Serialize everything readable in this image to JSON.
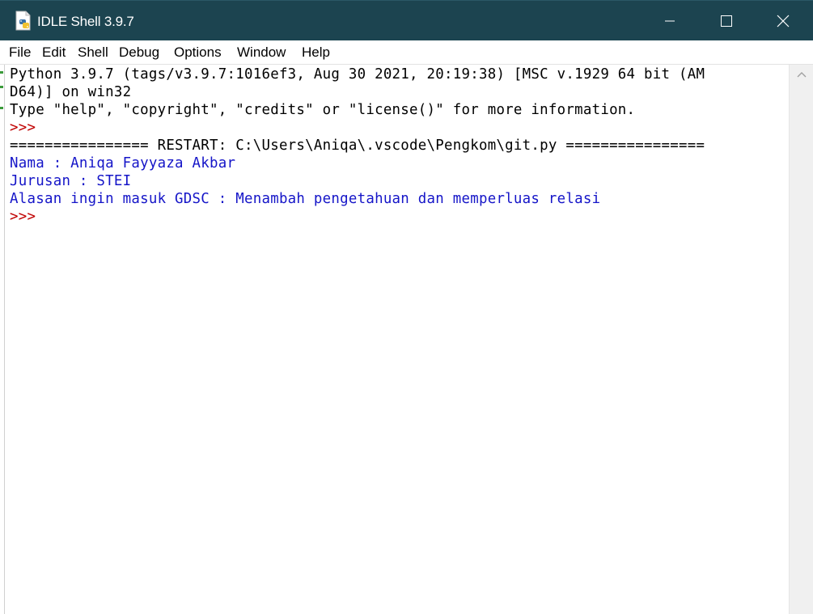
{
  "window": {
    "title": "IDLE Shell 3.9.7"
  },
  "menubar": {
    "items": [
      "File",
      "Edit",
      "Shell",
      "Debug",
      "Options",
      "Window",
      "Help"
    ]
  },
  "shell": {
    "lines": [
      {
        "text": "Python 3.9.7 (tags/v3.9.7:1016ef3, Aug 30 2021, 20:19:38) [MSC v.1929 64 bit (AM",
        "kind": "stdout-banner"
      },
      {
        "text": "D64)] on win32",
        "kind": "stdout-banner"
      },
      {
        "text": "Type \"help\", \"copyright\", \"credits\" or \"license()\" for more information.",
        "kind": "stdout-banner"
      },
      {
        "text": ">>> ",
        "kind": "prompt"
      },
      {
        "text": "================ RESTART: C:\\Users\\Aniqa\\.vscode\\Pengkom\\git.py ================",
        "kind": "restart"
      },
      {
        "text": "Nama : Aniqa Fayyaza Akbar",
        "kind": "output"
      },
      {
        "text": "Jurusan : STEI",
        "kind": "output"
      },
      {
        "text": "Alasan ingin masuk GDSC : Menambah pengetahuan dan memperluas relasi",
        "kind": "output"
      },
      {
        "text": ">>> ",
        "kind": "prompt"
      }
    ]
  },
  "colors": {
    "titlebar": "#1c4450",
    "prompt": "#c00000",
    "output": "#1515c8",
    "text": "#000000"
  },
  "icons": {
    "app": "python-idle-icon",
    "minimize": "minimize-icon",
    "maximize": "maximize-icon",
    "close": "close-icon",
    "scroll_up": "scroll-up-arrow-icon"
  }
}
